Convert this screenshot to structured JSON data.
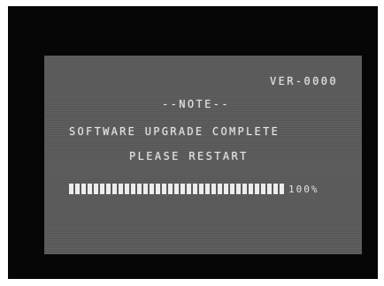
{
  "osd": {
    "version": "VER-0000",
    "note_title": "--NOTE--",
    "message_line1": "SOFTWARE UPGRADE COMPLETE",
    "message_line2": "PLEASE RESTART",
    "progress": {
      "value_percent": 100,
      "label": "100%"
    }
  },
  "colors": {
    "frame": "#060606",
    "screen_bg": "#5a5a5a",
    "text": "#e4e4e4"
  }
}
